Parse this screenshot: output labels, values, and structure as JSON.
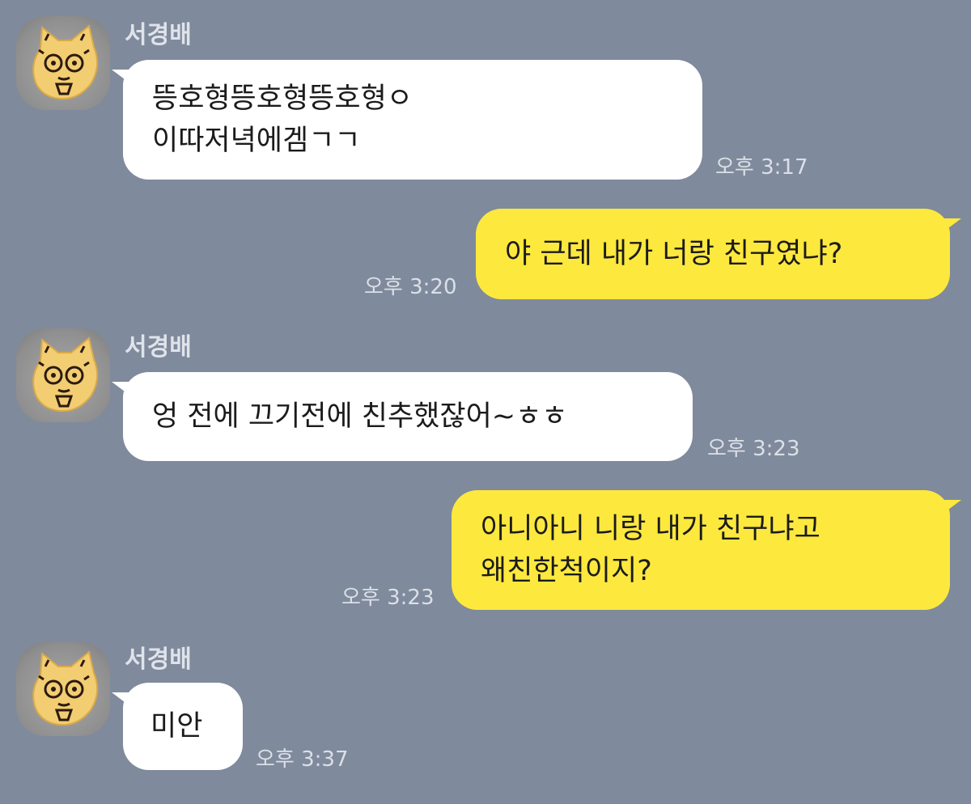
{
  "messages": [
    {
      "direction": "incoming",
      "sender": "서경배",
      "lines": [
        "뜽호형뜽호형뜽호형ㅇ",
        "이따저녁에겜ㄱㄱ"
      ],
      "time": "오후 3:17"
    },
    {
      "direction": "outgoing",
      "lines": [
        "야 근데 내가 너랑 친구였냐?"
      ],
      "time": "오후 3:20"
    },
    {
      "direction": "incoming",
      "sender": "서경배",
      "lines": [
        "엉 전에 끄기전에 친추했잖어~ㅎㅎ"
      ],
      "time": "오후 3:23"
    },
    {
      "direction": "outgoing",
      "lines": [
        "아니아니 니랑 내가 친구냐고",
        "왜친한척이지?"
      ],
      "time": "오후 3:23"
    },
    {
      "direction": "incoming",
      "sender": "서경배",
      "lines": [
        "미안"
      ],
      "time": "오후 3:37"
    }
  ],
  "colors": {
    "background": "#7f8a9c",
    "incoming_bubble": "#ffffff",
    "outgoing_bubble": "#fde83e"
  },
  "avatar_icon": "cat-cookie-icon"
}
